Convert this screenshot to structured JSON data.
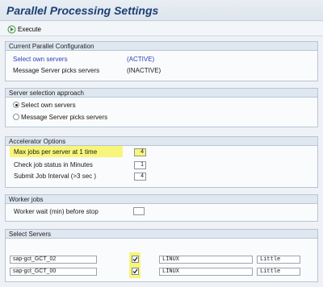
{
  "title": "Parallel Processing Settings",
  "toolbar": {
    "execute_label": "Execute"
  },
  "current_config": {
    "header": "Current Parallel Configuration",
    "rows": [
      {
        "label": "Select own servers",
        "status": "(ACTIVE)"
      },
      {
        "label": "Message Server picks servers",
        "status": "(INACTIVE)"
      }
    ]
  },
  "server_selection": {
    "header": "Server selection approach",
    "options": [
      {
        "label": "Select own servers",
        "selected": true
      },
      {
        "label": "Message Server picks servers",
        "selected": false
      }
    ]
  },
  "accelerator": {
    "header": "Accelerator Options",
    "fields": [
      {
        "label": "Max jobs per server at 1 time",
        "value": "4"
      },
      {
        "label": "Check job status in Minutes",
        "value": "1"
      },
      {
        "label": "Submit Job Interval (>3 sec )",
        "value": "4"
      }
    ]
  },
  "worker_jobs": {
    "header": "Worker jobs",
    "fields": [
      {
        "label": "Worker wait (min) before stop",
        "value": ""
      }
    ]
  },
  "select_servers": {
    "header": "Select Servers",
    "rows": [
      {
        "name": "sap-gct_GCT_02",
        "checked": true,
        "os": "LINUX",
        "endian": "Little"
      },
      {
        "name": "sap-gct_GCT_00",
        "checked": true,
        "os": "LINUX",
        "endian": "Little"
      }
    ]
  },
  "colors": {
    "title_text": "#1b3f73",
    "highlight": "#f7f57a",
    "link_blue": "#2f3fb8"
  }
}
